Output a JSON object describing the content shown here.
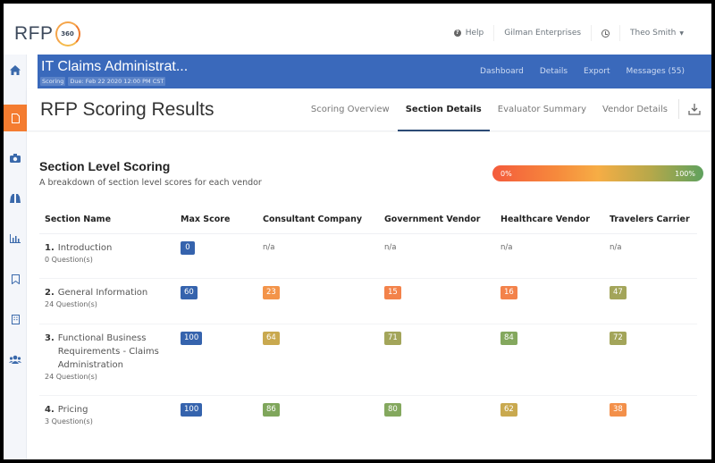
{
  "brand": {
    "logo_text": "RFP",
    "logo_number": "360"
  },
  "topnav": {
    "help": "Help",
    "company": "Gilman Enterprises",
    "user": "Theo Smith"
  },
  "project": {
    "title": "IT Claims Administrat...",
    "status_tag": "Scoring",
    "due_tag": "Due: Feb 22 2020 12:00 PM CST",
    "nav": [
      "Dashboard",
      "Details",
      "Export",
      "Messages (55)"
    ]
  },
  "sidebar": {
    "items": [
      {
        "icon": "home-icon",
        "glyph": "⌂"
      },
      {
        "icon": "document-icon",
        "glyph": "▤",
        "active": true
      },
      {
        "icon": "camera-icon",
        "glyph": "◙"
      },
      {
        "icon": "binoculars-icon",
        "glyph": "⚭"
      },
      {
        "icon": "bar-chart-icon",
        "glyph": "▥"
      },
      {
        "icon": "bookmark-icon",
        "glyph": "⛉"
      },
      {
        "icon": "building-icon",
        "glyph": "▦"
      },
      {
        "icon": "users-icon",
        "glyph": "⚇"
      }
    ]
  },
  "page": {
    "title": "RFP Scoring Results",
    "tabs": [
      "Scoring Overview",
      "Section Details",
      "Evaluator Summary",
      "Vendor Details"
    ],
    "active_tab": "Section Details"
  },
  "section": {
    "title": "Section Level Scoring",
    "subtitle": "A breakdown of section level scores for each vendor",
    "legend_min": "0%",
    "legend_max": "100%"
  },
  "colors": {
    "max_score": "#3563ad",
    "low": "#f3844a",
    "mid_low": "#f0944a",
    "mid": "#c9a94f",
    "mid_high": "#a3a55a",
    "high": "#7fa65b",
    "primary": "#3a69bb",
    "accent": "#f47c30"
  },
  "table": {
    "headers": [
      "Section Name",
      "Max Score",
      "Consultant Company",
      "Government Vendor",
      "Healthcare Vendor",
      "Travelers Carrier"
    ],
    "rows": [
      {
        "num": "1.",
        "name": "Introduction",
        "questions": "0 Question(s)",
        "max": "0",
        "scores": [
          {
            "v": "n/a"
          },
          {
            "v": "n/a"
          },
          {
            "v": "n/a"
          },
          {
            "v": "n/a"
          }
        ]
      },
      {
        "num": "2.",
        "name": "General Information",
        "questions": "24 Question(s)",
        "max": "60",
        "scores": [
          {
            "v": "23",
            "c": "#f3944a"
          },
          {
            "v": "15",
            "c": "#f3824a"
          },
          {
            "v": "16",
            "c": "#f3824a"
          },
          {
            "v": "47",
            "c": "#a3a55a"
          }
        ]
      },
      {
        "num": "3.",
        "name": "Functional Business Requirements - Claims Administration",
        "questions": "24 Question(s)",
        "max": "100",
        "scores": [
          {
            "v": "64",
            "c": "#c9a94f"
          },
          {
            "v": "71",
            "c": "#a3a55a"
          },
          {
            "v": "84",
            "c": "#84a85e"
          },
          {
            "v": "72",
            "c": "#a3a55a"
          }
        ]
      },
      {
        "num": "4.",
        "name": "Pricing",
        "questions": "3 Question(s)",
        "max": "100",
        "scores": [
          {
            "v": "86",
            "c": "#7fa65b"
          },
          {
            "v": "80",
            "c": "#84a85e"
          },
          {
            "v": "62",
            "c": "#c9a94f"
          },
          {
            "v": "38",
            "c": "#f3904a"
          }
        ]
      }
    ]
  }
}
